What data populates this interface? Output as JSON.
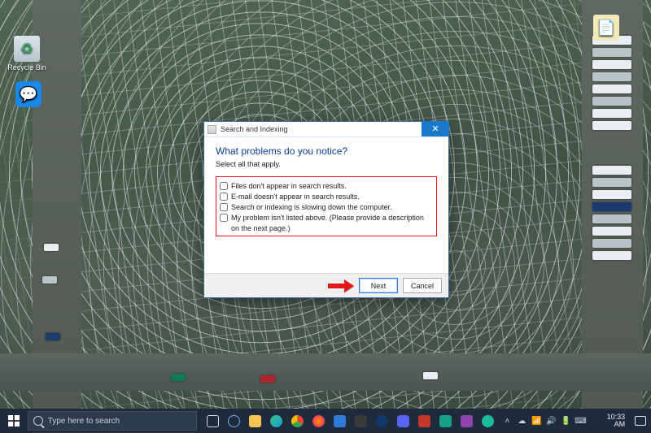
{
  "desktop_icons": {
    "recycle": {
      "label": "Recycle Bin",
      "glyph": "♻"
    },
    "chat": {
      "label": "",
      "glyph": "💬"
    },
    "right": {
      "label": "",
      "glyph": "📄"
    }
  },
  "dialog": {
    "title": "Search and Indexing",
    "heading": "What problems do you notice?",
    "subheading": "Select all that apply.",
    "options": [
      "Files don't appear in search results.",
      "E-mail doesn't appear in search results.",
      "Search or indexing is slowing down the computer.",
      "My problem isn't listed above. (Please provide a description on the next page.)"
    ],
    "next_label": "Next",
    "cancel_label": "Cancel",
    "close_glyph": "✕"
  },
  "taskbar": {
    "search_placeholder": "Type here to search",
    "clock_time": "10:33 AM",
    "clock_date": ""
  }
}
